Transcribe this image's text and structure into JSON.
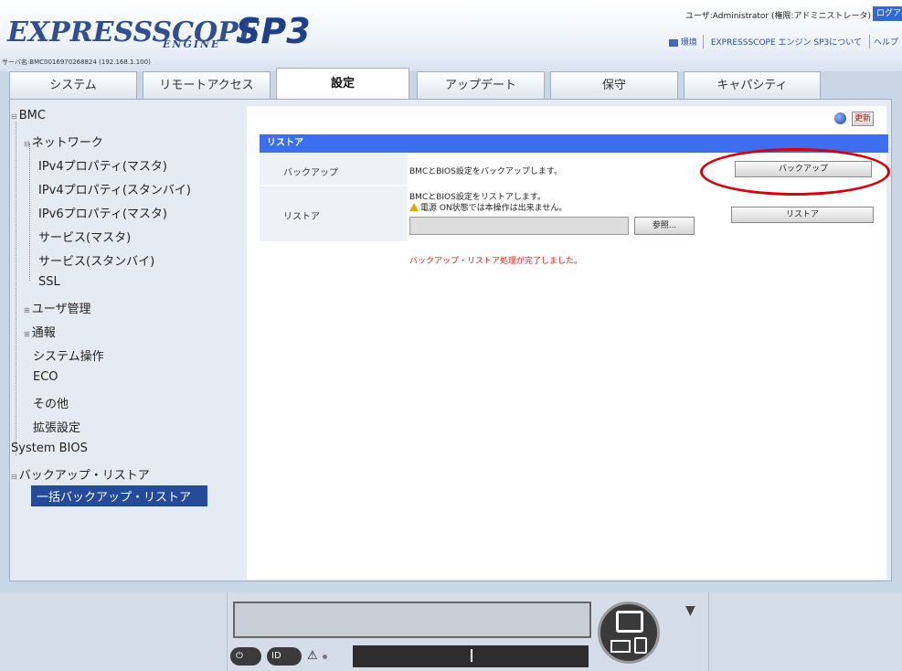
{
  "header": {
    "logo_word": "EXPRESSSCOPE",
    "logo_engine": "ENGINE",
    "logo_sp3": "SP3",
    "server_name": "サーバ名:BMC0016970268824 (192.168.1.100)",
    "user_info": "ユーザ:Administrator (権限:アドミニストレータ)",
    "logout_label": "ログアウト",
    "links": {
      "env": "環境",
      "about": "EXPRESSSCOPE エンジン SP3について",
      "help": "ヘルプ"
    }
  },
  "tabs": [
    {
      "label": "システム"
    },
    {
      "label": "リモートアクセス"
    },
    {
      "label": "設定"
    },
    {
      "label": "アップデート"
    },
    {
      "label": "保守"
    },
    {
      "label": "キャパシティ"
    }
  ],
  "active_tab": "設定",
  "sidebar": {
    "bmc": "BMC",
    "network": "ネットワーク",
    "network_items": [
      "IPv4プロパティ(マスタ)",
      "IPv4プロパティ(スタンバイ)",
      "IPv6プロパティ(マスタ)",
      "サービス(マスタ)",
      "サービス(スタンバイ)",
      "SSL"
    ],
    "user_mgmt": "ユーザ管理",
    "notify": "通報",
    "system_ops": "システム操作",
    "eco": "ECO",
    "other": "その他",
    "extended": "拡張設定",
    "system_bios": "System BIOS",
    "backup_restore": "バックアップ・リストア",
    "bulk_backup_restore": "一括バックアップ・リストア"
  },
  "content": {
    "refresh_label": "更新",
    "section_title": "リストア",
    "backup_row": {
      "label": "バックアップ",
      "description": "BMCとBIOS設定をバックアップします。",
      "button_label": "バックアップ"
    },
    "restore_row": {
      "label": "リストア",
      "description": "BMCとBIOS設定をリストアします。",
      "warning": "電源 ON状態では本操作は出来ません。",
      "browse_label": "参照...",
      "button_label": "リストア"
    },
    "status_message": "バックアップ・リストア処理が完了しました。"
  },
  "bottom": {
    "power_label": "⏻",
    "id_label": "ID"
  },
  "colors": {
    "section_header": "#3c6ef0",
    "selected_item": "#264a9a",
    "status_message": "#e0200f",
    "highlight_ring": "#d8000a"
  }
}
